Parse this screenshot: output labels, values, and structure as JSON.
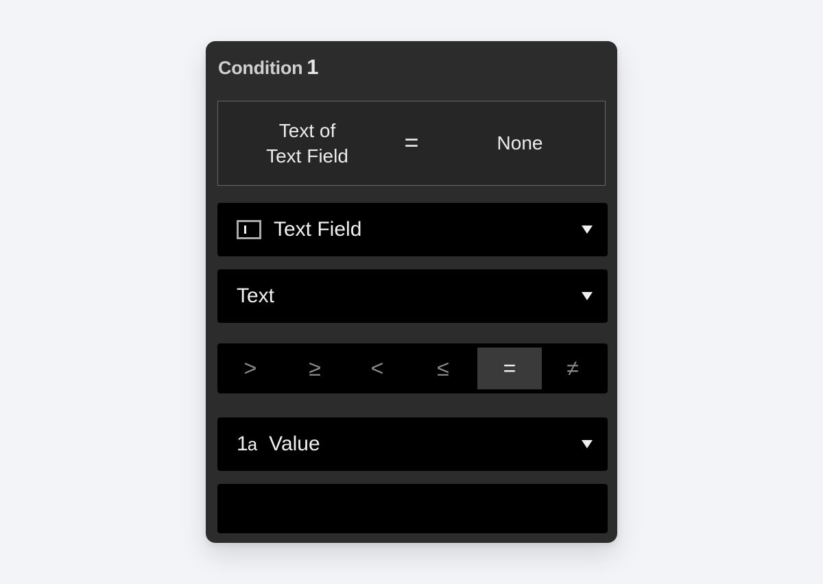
{
  "panel": {
    "title_label": "Condition",
    "title_number": "1"
  },
  "summary": {
    "left_line1": "Text of",
    "left_line2": "Text Field",
    "operator": "=",
    "right": "None"
  },
  "source_dropdown": {
    "icon": "text-field-icon",
    "label": "Text Field"
  },
  "property_dropdown": {
    "label": "Text"
  },
  "operators": [
    ">",
    "≥",
    "<",
    "≤",
    "=",
    "≠"
  ],
  "selected_operator": "=",
  "value_dropdown": {
    "icon_main": "1",
    "icon_sub": "a",
    "label": "Value"
  },
  "value_input": {
    "value": ""
  },
  "colors": {
    "background": "#f3f4f8",
    "panel": "#2c2c2c",
    "control": "#000000",
    "active_operator": "#3a3a3a"
  }
}
